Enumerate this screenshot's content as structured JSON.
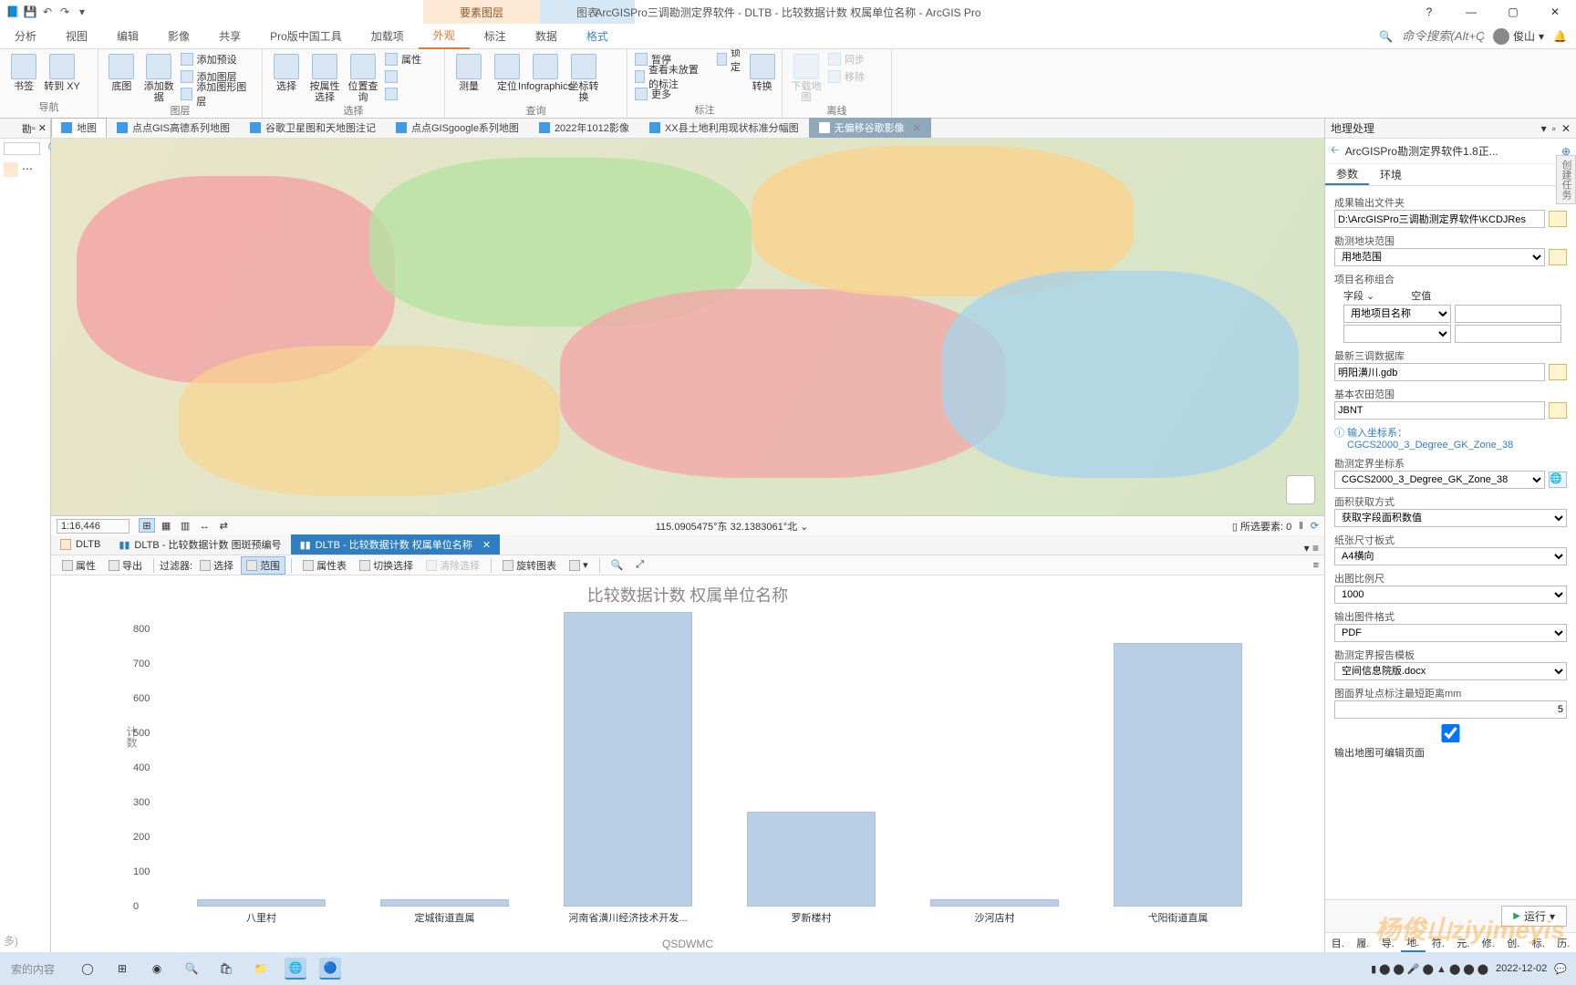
{
  "title": "ArcGISPro三调勘测定界软件 - DLTB - 比较数据计数 权属单位名称 - ArcGIS Pro",
  "context_tabs": [
    "要素图层",
    "图表"
  ],
  "menu": [
    "分析",
    "视图",
    "编辑",
    "影像",
    "共享",
    "Pro版中国工具",
    "加载项",
    "外观",
    "标注",
    "数据",
    "格式"
  ],
  "search_placeholder": "命令搜索(Alt+Q)",
  "user": "俊山",
  "ribbon": {
    "nav": {
      "bookmarks": "书签",
      "goto": "转到\nXY",
      "label": "导航"
    },
    "layer": {
      "basemap": "底图",
      "adddata": "添加数据",
      "addpreset": "添加预设",
      "addlayer": "添加图层",
      "addgraphics": "添加图形图层",
      "label": "图层"
    },
    "select": {
      "select": "选择",
      "byattr": "按属性选择",
      "byloc": "位置查询",
      "attrs": "属性",
      "label": "选择"
    },
    "query": {
      "measure": "测量",
      "locate": "定位",
      "info": "Infographics",
      "coord": "坐标转换",
      "label": "查询"
    },
    "label": {
      "pause": "暂停",
      "viewunplaced": "查看未放置的标注",
      "more": "更多",
      "lock": "锁定",
      "convert": "转换",
      "label_g": "标注"
    },
    "offline": {
      "download": "下载地图",
      "sync": "同步",
      "remove": "移除",
      "label": "离线"
    }
  },
  "map_tabs": [
    {
      "t": "地图"
    },
    {
      "t": "点点GIS高德系列地图"
    },
    {
      "t": "谷歌卫星图和天地图注记"
    },
    {
      "t": "点点GISgoogle系列地图"
    },
    {
      "t": "2022年1012影像"
    },
    {
      "t": "XX县土地利用现状标准分幅图"
    },
    {
      "t": "无偏移谷歌影像",
      "dark": true
    }
  ],
  "map_status": {
    "scale": "1:16,446",
    "coords": "115.0905475°东 32.1383061°北",
    "sel": "所选要素: 0"
  },
  "bottom_tabs": [
    {
      "t": "DLTB"
    },
    {
      "t": "DLTB - 比较数据计数 图斑预编号"
    },
    {
      "t": "DLTB - 比较数据计数 权属单位名称",
      "active": true
    }
  ],
  "chart_toolbar": {
    "attrs": "属性",
    "export": "导出",
    "filter": "过滤器:",
    "select": "选择",
    "range": "范围",
    "attrtable": "属性表",
    "switchsel": "切换选择",
    "clearsel": "清除选择",
    "rotate": "旋转图表"
  },
  "chart_data": {
    "type": "bar",
    "title": "比较数据计数 权属单位名称",
    "ylabel": "计数",
    "xlabel": "QSDWMC",
    "ylim": [
      0,
      850
    ],
    "categories": [
      "八里村",
      "定城街道直属",
      "河南省潢川经济技术开发...",
      "罗新楼村",
      "沙河店村",
      "弋阳街道直属"
    ],
    "values": [
      20,
      20,
      850,
      275,
      20,
      760
    ]
  },
  "gp": {
    "title": "地理处理",
    "tool": "ArcGISPro勘测定界软件1.8正...",
    "tabs": [
      "参数",
      "环境"
    ],
    "f": {
      "out_label": "成果输出文件夹",
      "out_val": "D:\\ArcGISPro三调勘测定界软件\\KCDJRes",
      "scope_label": "勘测地块范围",
      "scope_val": "用地范围",
      "combo_label": "项目名称组合",
      "field": "字段",
      "empty": "空值",
      "field_val": "用地项目名称",
      "db_label": "最新三调数据库",
      "db_val": "明阳潢川.gdb",
      "jbnt_label": "基本农田范围",
      "jbnt_val": "JBNT",
      "crs_in_label": "输入坐标系：",
      "crs_in_val": "CGCS2000_3_Degree_GK_Zone_38",
      "crs_out_label": "勘测定界坐标系",
      "crs_out_val": "CGCS2000_3_Degree_GK_Zone_38",
      "area_label": "面积获取方式",
      "area_val": "获取字段面积数值",
      "paper_label": "纸张尺寸板式",
      "paper_val": "A4横向",
      "scale_label": "出图比例尺",
      "scale_val": "1000",
      "fmt_label": "输出图件格式",
      "fmt_val": "PDF",
      "tmpl_label": "勘测定界报告模板",
      "tmpl_val": "空间信息院版.docx",
      "dist_label": "图面界址点标注最短距离mm",
      "dist_val": "5",
      "edit_label": "输出地图可编辑页面",
      "run": "运行"
    },
    "cats": [
      "目.",
      "履.",
      "导.",
      "地.",
      "符.",
      "元.",
      "修.",
      "创.",
      "标.",
      "历."
    ]
  },
  "left": {
    "search": "索的内容",
    "pane1": "勘"
  },
  "taskbar": {
    "date": "2022-12-02"
  },
  "watermark": "杨俊山ziyimeyis",
  "vt": "创建任务"
}
